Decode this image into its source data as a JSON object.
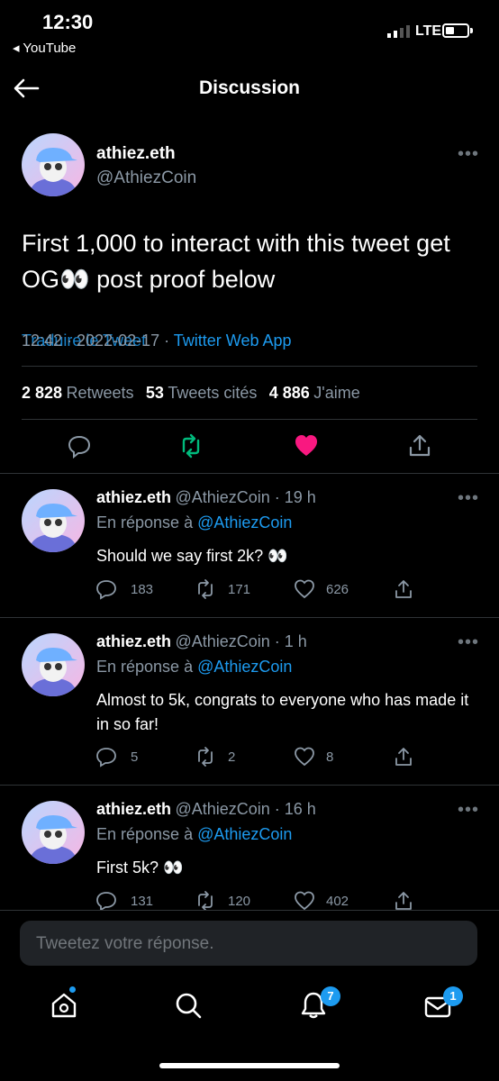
{
  "status_bar": {
    "time": "12:30",
    "back_app": "◂ YouTube",
    "network": "LTE"
  },
  "header": {
    "title": "Discussion"
  },
  "main_tweet": {
    "name": "athiez.eth",
    "handle": "@AthiezCoin",
    "text": "First 1,000 to interact with this tweet get OG👀 post proof below",
    "translate": "Traduire le Tweet",
    "date": "12:42 · 2022-02-17 · ",
    "source": "Twitter Web App",
    "stats": [
      {
        "num": "2 828",
        "label": "Retweets"
      },
      {
        "num": "53",
        "label": "Tweets cités"
      },
      {
        "num": "4 886",
        "label": "J'aime"
      }
    ]
  },
  "replies": [
    {
      "name": "athiez.eth",
      "handle": "@AthiezCoin · 19 h",
      "reply_prefix": "En réponse à ",
      "reply_to": "@AthiezCoin",
      "text": "Should we say first 2k? 👀",
      "replies": "183",
      "retweets": "171",
      "likes": "626"
    },
    {
      "name": "athiez.eth",
      "handle": "@AthiezCoin · 1 h",
      "reply_prefix": "En réponse à ",
      "reply_to": "@AthiezCoin",
      "text": "Almost to 5k, congrats to everyone who has made it in so far!",
      "replies": "5",
      "retweets": "2",
      "likes": "8"
    },
    {
      "name": "athiez.eth",
      "handle": "@AthiezCoin · 16 h",
      "reply_prefix": "En réponse à ",
      "reply_to": "@AthiezCoin",
      "text": "First 5k? 👀",
      "replies": "131",
      "retweets": "120",
      "likes": "402"
    }
  ],
  "composer": {
    "placeholder": "Tweetez votre réponse."
  },
  "tabbar": {
    "notifications_badge": "7",
    "messages_badge": "1"
  },
  "colors": {
    "accent": "#1d9bf0",
    "like": "#f91880",
    "retweet": "#00ba7c",
    "background": "#000000"
  },
  "icons": [
    "back-arrow-icon",
    "more-icon",
    "reply-icon",
    "retweet-icon",
    "like-icon",
    "share-icon",
    "home-icon",
    "search-icon",
    "bell-icon",
    "mail-icon"
  ]
}
